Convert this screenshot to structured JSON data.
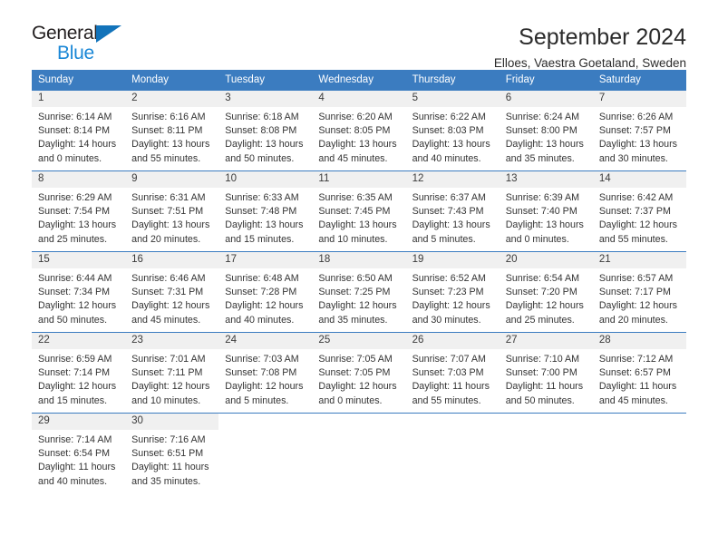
{
  "brand": {
    "name_part1": "General",
    "name_part2": "Blue",
    "accent_color": "#1a87d6",
    "triangle_color": "#1273ba"
  },
  "header": {
    "title": "September 2024",
    "subtitle": "Elloes, Vaestra Goetaland, Sweden",
    "header_bg_color": "#3b7cc0"
  },
  "weekdays": [
    "Sunday",
    "Monday",
    "Tuesday",
    "Wednesday",
    "Thursday",
    "Friday",
    "Saturday"
  ],
  "weeks": [
    [
      {
        "day": "1",
        "sunrise": "Sunrise: 6:14 AM",
        "sunset": "Sunset: 8:14 PM",
        "daylight": "Daylight: 14 hours and 0 minutes."
      },
      {
        "day": "2",
        "sunrise": "Sunrise: 6:16 AM",
        "sunset": "Sunset: 8:11 PM",
        "daylight": "Daylight: 13 hours and 55 minutes."
      },
      {
        "day": "3",
        "sunrise": "Sunrise: 6:18 AM",
        "sunset": "Sunset: 8:08 PM",
        "daylight": "Daylight: 13 hours and 50 minutes."
      },
      {
        "day": "4",
        "sunrise": "Sunrise: 6:20 AM",
        "sunset": "Sunset: 8:05 PM",
        "daylight": "Daylight: 13 hours and 45 minutes."
      },
      {
        "day": "5",
        "sunrise": "Sunrise: 6:22 AM",
        "sunset": "Sunset: 8:03 PM",
        "daylight": "Daylight: 13 hours and 40 minutes."
      },
      {
        "day": "6",
        "sunrise": "Sunrise: 6:24 AM",
        "sunset": "Sunset: 8:00 PM",
        "daylight": "Daylight: 13 hours and 35 minutes."
      },
      {
        "day": "7",
        "sunrise": "Sunrise: 6:26 AM",
        "sunset": "Sunset: 7:57 PM",
        "daylight": "Daylight: 13 hours and 30 minutes."
      }
    ],
    [
      {
        "day": "8",
        "sunrise": "Sunrise: 6:29 AM",
        "sunset": "Sunset: 7:54 PM",
        "daylight": "Daylight: 13 hours and 25 minutes."
      },
      {
        "day": "9",
        "sunrise": "Sunrise: 6:31 AM",
        "sunset": "Sunset: 7:51 PM",
        "daylight": "Daylight: 13 hours and 20 minutes."
      },
      {
        "day": "10",
        "sunrise": "Sunrise: 6:33 AM",
        "sunset": "Sunset: 7:48 PM",
        "daylight": "Daylight: 13 hours and 15 minutes."
      },
      {
        "day": "11",
        "sunrise": "Sunrise: 6:35 AM",
        "sunset": "Sunset: 7:45 PM",
        "daylight": "Daylight: 13 hours and 10 minutes."
      },
      {
        "day": "12",
        "sunrise": "Sunrise: 6:37 AM",
        "sunset": "Sunset: 7:43 PM",
        "daylight": "Daylight: 13 hours and 5 minutes."
      },
      {
        "day": "13",
        "sunrise": "Sunrise: 6:39 AM",
        "sunset": "Sunset: 7:40 PM",
        "daylight": "Daylight: 13 hours and 0 minutes."
      },
      {
        "day": "14",
        "sunrise": "Sunrise: 6:42 AM",
        "sunset": "Sunset: 7:37 PM",
        "daylight": "Daylight: 12 hours and 55 minutes."
      }
    ],
    [
      {
        "day": "15",
        "sunrise": "Sunrise: 6:44 AM",
        "sunset": "Sunset: 7:34 PM",
        "daylight": "Daylight: 12 hours and 50 minutes."
      },
      {
        "day": "16",
        "sunrise": "Sunrise: 6:46 AM",
        "sunset": "Sunset: 7:31 PM",
        "daylight": "Daylight: 12 hours and 45 minutes."
      },
      {
        "day": "17",
        "sunrise": "Sunrise: 6:48 AM",
        "sunset": "Sunset: 7:28 PM",
        "daylight": "Daylight: 12 hours and 40 minutes."
      },
      {
        "day": "18",
        "sunrise": "Sunrise: 6:50 AM",
        "sunset": "Sunset: 7:25 PM",
        "daylight": "Daylight: 12 hours and 35 minutes."
      },
      {
        "day": "19",
        "sunrise": "Sunrise: 6:52 AM",
        "sunset": "Sunset: 7:23 PM",
        "daylight": "Daylight: 12 hours and 30 minutes."
      },
      {
        "day": "20",
        "sunrise": "Sunrise: 6:54 AM",
        "sunset": "Sunset: 7:20 PM",
        "daylight": "Daylight: 12 hours and 25 minutes."
      },
      {
        "day": "21",
        "sunrise": "Sunrise: 6:57 AM",
        "sunset": "Sunset: 7:17 PM",
        "daylight": "Daylight: 12 hours and 20 minutes."
      }
    ],
    [
      {
        "day": "22",
        "sunrise": "Sunrise: 6:59 AM",
        "sunset": "Sunset: 7:14 PM",
        "daylight": "Daylight: 12 hours and 15 minutes."
      },
      {
        "day": "23",
        "sunrise": "Sunrise: 7:01 AM",
        "sunset": "Sunset: 7:11 PM",
        "daylight": "Daylight: 12 hours and 10 minutes."
      },
      {
        "day": "24",
        "sunrise": "Sunrise: 7:03 AM",
        "sunset": "Sunset: 7:08 PM",
        "daylight": "Daylight: 12 hours and 5 minutes."
      },
      {
        "day": "25",
        "sunrise": "Sunrise: 7:05 AM",
        "sunset": "Sunset: 7:05 PM",
        "daylight": "Daylight: 12 hours and 0 minutes."
      },
      {
        "day": "26",
        "sunrise": "Sunrise: 7:07 AM",
        "sunset": "Sunset: 7:03 PM",
        "daylight": "Daylight: 11 hours and 55 minutes."
      },
      {
        "day": "27",
        "sunrise": "Sunrise: 7:10 AM",
        "sunset": "Sunset: 7:00 PM",
        "daylight": "Daylight: 11 hours and 50 minutes."
      },
      {
        "day": "28",
        "sunrise": "Sunrise: 7:12 AM",
        "sunset": "Sunset: 6:57 PM",
        "daylight": "Daylight: 11 hours and 45 minutes."
      }
    ],
    [
      {
        "day": "29",
        "sunrise": "Sunrise: 7:14 AM",
        "sunset": "Sunset: 6:54 PM",
        "daylight": "Daylight: 11 hours and 40 minutes."
      },
      {
        "day": "30",
        "sunrise": "Sunrise: 7:16 AM",
        "sunset": "Sunset: 6:51 PM",
        "daylight": "Daylight: 11 hours and 35 minutes."
      },
      {
        "day": "",
        "sunrise": "",
        "sunset": "",
        "daylight": ""
      },
      {
        "day": "",
        "sunrise": "",
        "sunset": "",
        "daylight": ""
      },
      {
        "day": "",
        "sunrise": "",
        "sunset": "",
        "daylight": ""
      },
      {
        "day": "",
        "sunrise": "",
        "sunset": "",
        "daylight": ""
      },
      {
        "day": "",
        "sunrise": "",
        "sunset": "",
        "daylight": ""
      }
    ]
  ]
}
